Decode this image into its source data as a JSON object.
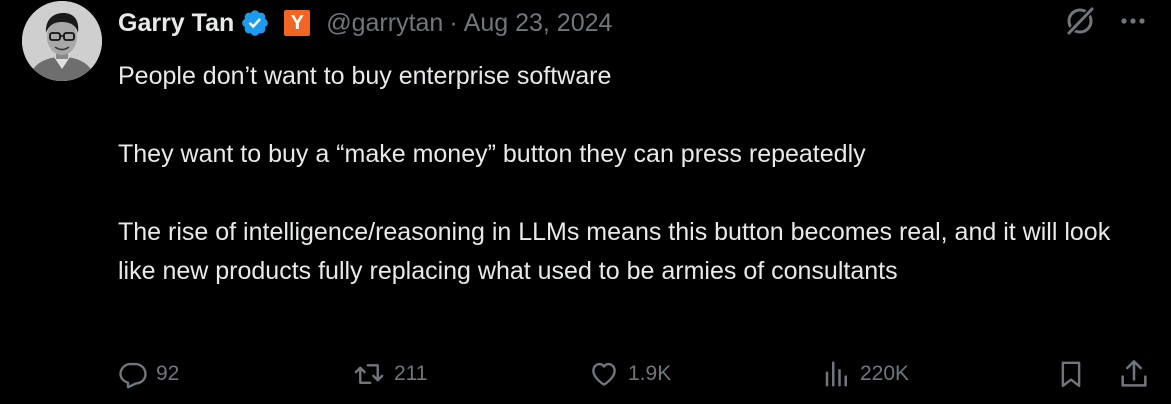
{
  "author": {
    "name": "Garry Tan",
    "badge_letter": "Y",
    "handle": "@garrytan",
    "separator": "·",
    "date": "Aug 23, 2024"
  },
  "tweet": {
    "paragraphs": [
      "People don’t want to buy enterprise software",
      "They want to buy a “make money” button they can press repeatedly",
      "The rise of intelligence/reasoning in LLMs means this button becomes real, and it will look like new products fully replacing what used to be armies of consultants"
    ]
  },
  "actions": {
    "replies": "92",
    "reposts": "211",
    "likes": "1.9K",
    "views": "220K"
  },
  "icons": {
    "reply": "reply-icon",
    "repost": "repost-icon",
    "like": "heart-icon",
    "views": "views-icon",
    "bookmark": "bookmark-icon",
    "share": "share-icon",
    "grok": "grok-icon",
    "more": "more-icon",
    "verified": "verified-badge-icon"
  },
  "colors": {
    "background": "#000000",
    "text": "#e7e9ea",
    "muted": "#71767b",
    "verified": "#1d9bf0",
    "yc_orange": "#f26522"
  }
}
